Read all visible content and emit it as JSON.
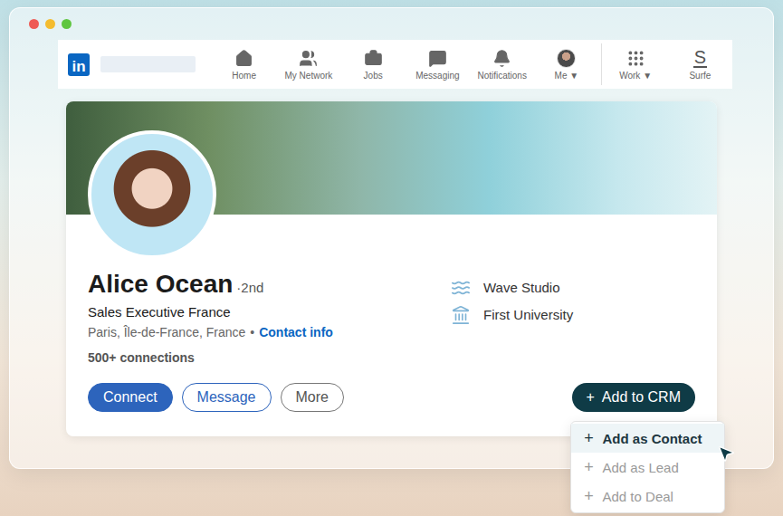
{
  "window": {
    "controls": [
      {
        "color": "#ee5b55"
      },
      {
        "color": "#f4bc2f"
      },
      {
        "color": "#5fc640"
      }
    ]
  },
  "nav": {
    "logo": "in",
    "items": [
      {
        "label": "Home",
        "kind": "icon",
        "caret": "",
        "divider_before": false
      },
      {
        "label": "My Network",
        "kind": "icon",
        "caret": "",
        "divider_before": false
      },
      {
        "label": "Jobs",
        "kind": "icon",
        "caret": "",
        "divider_before": false
      },
      {
        "label": "Messaging",
        "kind": "icon",
        "caret": "",
        "divider_before": false
      },
      {
        "label": "Notifications",
        "kind": "icon",
        "caret": "",
        "divider_before": false
      },
      {
        "label": "Me",
        "kind": "avatar",
        "caret": "▼",
        "divider_before": false
      },
      {
        "label": "Work",
        "kind": "icon",
        "caret": "▼",
        "divider_before": true
      },
      {
        "label": "Surfe",
        "kind": "logo",
        "logo": "S",
        "caret": "",
        "divider_before": false
      }
    ]
  },
  "profile": {
    "name": "Alice Ocean",
    "degree": "·2nd",
    "headline": "Sales Executive France",
    "location": "Paris, Île-de-France, France",
    "separator": "•",
    "contact_link": "Contact info",
    "connections": "500+ connections",
    "experience": [
      {
        "label": "Wave Studio"
      },
      {
        "label": "First University"
      }
    ]
  },
  "actions": [
    {
      "label": "Connect",
      "kind": "primary"
    },
    {
      "label": "Message",
      "kind": "outline"
    },
    {
      "label": "More",
      "kind": "neutral"
    }
  ],
  "crm": {
    "icon": "+",
    "label": "Add to CRM",
    "expanded": true,
    "menu": [
      {
        "icon": "+",
        "label": "Add as Contact",
        "selected": true,
        "disabled": false
      },
      {
        "icon": "+",
        "label": "Add as Lead",
        "selected": false,
        "disabled": true
      },
      {
        "icon": "+",
        "label": "Add to Deal",
        "selected": false,
        "disabled": true
      }
    ]
  }
}
